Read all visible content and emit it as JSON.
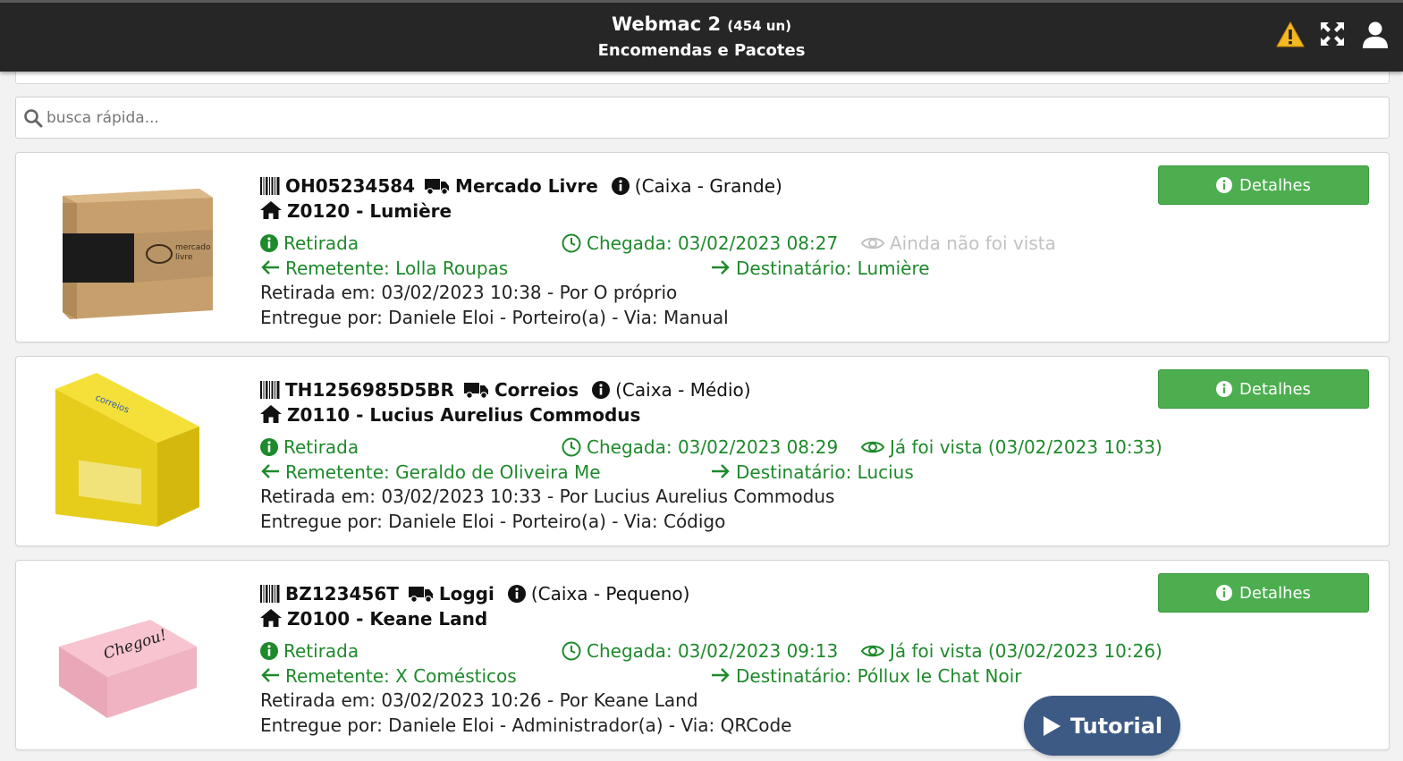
{
  "header": {
    "title": "Webmac 2",
    "count": "(454 un)",
    "subtitle": "Encomendas e Pacotes",
    "icons": [
      "warning-icon",
      "fullscreen-icon",
      "user-icon"
    ]
  },
  "search": {
    "placeholder": "busca rápida..."
  },
  "packages": [
    {
      "code": "OH05234584",
      "carrier": "Mercado Livre",
      "size": "(Caixa - Grande)",
      "unit": "Z0120 - Lumière",
      "status": "Retirada",
      "arrival": "Chegada: 03/02/2023 08:27",
      "seen": "Ainda não foi vista",
      "sender": "Remetente: Lolla Roupas",
      "recipient": "Destinatário: Lumière",
      "pickup": "Retirada em: 03/02/2023 10:38 - Por O próprio",
      "delivered_by": "Entregue por: Daniele Eloi - Porteiro(a) - Via: Manual",
      "details_label": "Detalhes"
    },
    {
      "code": "TH1256985D5BR",
      "carrier": "Correios",
      "size": "(Caixa - Médio)",
      "unit": "Z0110 - Lucius Aurelius Commodus",
      "status": "Retirada",
      "arrival": "Chegada: 03/02/2023 08:29",
      "seen": "Já foi vista (03/02/2023 10:33)",
      "sender": "Remetente: Geraldo de Oliveira Me",
      "recipient": "Destinatário: Lucius",
      "pickup": "Retirada em: 03/02/2023 10:33 - Por Lucius Aurelius Commodus",
      "delivered_by": "Entregue por: Daniele Eloi - Porteiro(a) - Via: Código",
      "details_label": "Detalhes"
    },
    {
      "code": "BZ123456T",
      "carrier": "Loggi",
      "size": "(Caixa - Pequeno)",
      "unit": "Z0100 - Keane Land",
      "status": "Retirada",
      "arrival": "Chegada: 03/02/2023 09:13",
      "seen": "Já foi vista (03/02/2023 10:26)",
      "sender": "Remetente: X Comésticos",
      "recipient": "Destinatário: Póllux le Chat Noir",
      "pickup": "Retirada em: 03/02/2023 10:26 - Por Keane Land",
      "delivered_by": "Entregue por: Daniele Eloi - Administrador(a) - Via: QRCode",
      "details_label": "Detalhes"
    }
  ],
  "tutorial": {
    "label": "Tutorial"
  },
  "colors": {
    "header_bg": "#262626",
    "green": "#1e8a2b",
    "button_green": "#4cae4f",
    "tutorial_bg": "#3d5a85"
  }
}
